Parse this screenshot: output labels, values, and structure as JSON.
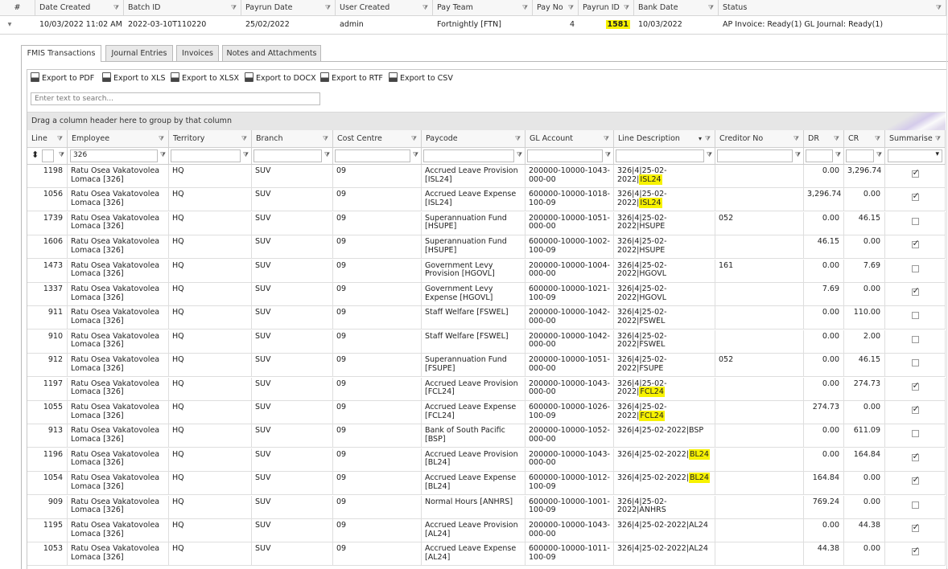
{
  "batch_grid": {
    "headers": [
      "#",
      "Date Created",
      "Batch ID",
      "Payrun Date",
      "User Created",
      "Pay Team",
      "Pay No",
      "Payrun ID",
      "Bank Date",
      "Status"
    ],
    "row": {
      "expand": "▾",
      "date_created": "10/03/2022 11:02 AM",
      "batch_id": "2022-03-10T110220",
      "payrun_date": "25/02/2022",
      "user_created": "admin",
      "pay_team": "Fortnightly [FTN]",
      "pay_no": "4",
      "payrun_id": "1581",
      "bank_date": "10/03/2022",
      "status": "AP Invoice: Ready(1) GL Journal: Ready(1)"
    }
  },
  "tabs": [
    "FMIS Transactions",
    "Journal Entries",
    "Invoices",
    "Notes and Attachments"
  ],
  "toolbar": [
    "Export to PDF",
    "Export to XLS",
    "Export to XLSX",
    "Export to DOCX",
    "Export to RTF",
    "Export to CSV"
  ],
  "search_placeholder": "Enter text to search...",
  "group_hint": "Drag a column header here to group by that column",
  "columns": [
    "Line",
    "Employee",
    "Territory",
    "Branch",
    "Cost Centre",
    "Paycode",
    "GL Account",
    "Line Description",
    "Creditor No",
    "DR",
    "CR",
    "Summarise"
  ],
  "filter_employee": "326",
  "rows": [
    {
      "line": "1198",
      "employee": "Ratu Osea Vakatovolea Lomaca [326]",
      "territory": "HQ",
      "branch": "SUV",
      "cost_centre": "09",
      "paycode": "Accrued Leave Provision [ISL24]",
      "gl": "200000-10000-1043-000-00",
      "desc_pre": "326|4|25-02-2022|",
      "desc_hl": "ISL24",
      "creditor": "",
      "dr": "0.00",
      "cr": "3,296.74",
      "summ": true
    },
    {
      "line": "1056",
      "employee": "Ratu Osea Vakatovolea Lomaca [326]",
      "territory": "HQ",
      "branch": "SUV",
      "cost_centre": "09",
      "paycode": "Accrued Leave Expense [ISL24]",
      "gl": "600000-10000-1018-100-09",
      "desc_pre": "326|4|25-02-2022|",
      "desc_hl": "ISL24",
      "creditor": "",
      "dr": "3,296.74",
      "cr": "0.00",
      "summ": true
    },
    {
      "line": "1739",
      "employee": "Ratu Osea Vakatovolea Lomaca [326]",
      "territory": "HQ",
      "branch": "SUV",
      "cost_centre": "09",
      "paycode": "Superannuation Fund [HSUPE]",
      "gl": "200000-10000-1051-000-00",
      "desc_pre": "326|4|25-02-2022|HSUPE",
      "desc_hl": "",
      "creditor": "052",
      "dr": "0.00",
      "cr": "46.15",
      "summ": false
    },
    {
      "line": "1606",
      "employee": "Ratu Osea Vakatovolea Lomaca [326]",
      "territory": "HQ",
      "branch": "SUV",
      "cost_centre": "09",
      "paycode": "Superannuation Fund [HSUPE]",
      "gl": "600000-10000-1002-100-09",
      "desc_pre": "326|4|25-02-2022|HSUPE",
      "desc_hl": "",
      "creditor": "",
      "dr": "46.15",
      "cr": "0.00",
      "summ": true
    },
    {
      "line": "1473",
      "employee": "Ratu Osea Vakatovolea Lomaca [326]",
      "territory": "HQ",
      "branch": "SUV",
      "cost_centre": "09",
      "paycode": "Government Levy Provision [HGOVL]",
      "gl": "200000-10000-1004-000-00",
      "desc_pre": "326|4|25-02-2022|HGOVL",
      "desc_hl": "",
      "creditor": "161",
      "dr": "0.00",
      "cr": "7.69",
      "summ": false
    },
    {
      "line": "1337",
      "employee": "Ratu Osea Vakatovolea Lomaca [326]",
      "territory": "HQ",
      "branch": "SUV",
      "cost_centre": "09",
      "paycode": "Government Levy Expense [HGOVL]",
      "gl": "600000-10000-1021-100-09",
      "desc_pre": "326|4|25-02-2022|HGOVL",
      "desc_hl": "",
      "creditor": "",
      "dr": "7.69",
      "cr": "0.00",
      "summ": true
    },
    {
      "line": "911",
      "employee": "Ratu Osea Vakatovolea Lomaca [326]",
      "territory": "HQ",
      "branch": "SUV",
      "cost_centre": "09",
      "paycode": "Staff Welfare [FSWEL]",
      "gl": "200000-10000-1042-000-00",
      "desc_pre": "326|4|25-02-2022|FSWEL",
      "desc_hl": "",
      "creditor": "",
      "dr": "0.00",
      "cr": "110.00",
      "summ": false
    },
    {
      "line": "910",
      "employee": "Ratu Osea Vakatovolea Lomaca [326]",
      "territory": "HQ",
      "branch": "SUV",
      "cost_centre": "09",
      "paycode": "Staff Welfare [FSWEL]",
      "gl": "200000-10000-1042-000-00",
      "desc_pre": "326|4|25-02-2022|FSWEL",
      "desc_hl": "",
      "creditor": "",
      "dr": "0.00",
      "cr": "2.00",
      "summ": false
    },
    {
      "line": "912",
      "employee": "Ratu Osea Vakatovolea Lomaca [326]",
      "territory": "HQ",
      "branch": "SUV",
      "cost_centre": "09",
      "paycode": "Superannuation Fund [FSUPE]",
      "gl": "200000-10000-1051-000-00",
      "desc_pre": "326|4|25-02-2022|FSUPE",
      "desc_hl": "",
      "creditor": "052",
      "dr": "0.00",
      "cr": "46.15",
      "summ": false
    },
    {
      "line": "1197",
      "employee": "Ratu Osea Vakatovolea Lomaca [326]",
      "territory": "HQ",
      "branch": "SUV",
      "cost_centre": "09",
      "paycode": "Accrued Leave Provision [FCL24]",
      "gl": "200000-10000-1043-000-00",
      "desc_pre": "326|4|25-02-2022|",
      "desc_hl": "FCL24",
      "creditor": "",
      "dr": "0.00",
      "cr": "274.73",
      "summ": true
    },
    {
      "line": "1055",
      "employee": "Ratu Osea Vakatovolea Lomaca [326]",
      "territory": "HQ",
      "branch": "SUV",
      "cost_centre": "09",
      "paycode": "Accrued Leave Expense [FCL24]",
      "gl": "600000-10000-1026-100-09",
      "desc_pre": "326|4|25-02-2022|",
      "desc_hl": "FCL24",
      "creditor": "",
      "dr": "274.73",
      "cr": "0.00",
      "summ": true
    },
    {
      "line": "913",
      "employee": "Ratu Osea Vakatovolea Lomaca [326]",
      "territory": "HQ",
      "branch": "SUV",
      "cost_centre": "09",
      "paycode": "Bank of South Pacific [BSP]",
      "gl": "200000-10000-1052-000-00",
      "desc_pre": "326|4|25-02-2022|BSP",
      "desc_hl": "",
      "creditor": "",
      "dr": "0.00",
      "cr": "611.09",
      "summ": false
    },
    {
      "line": "1196",
      "employee": "Ratu Osea Vakatovolea Lomaca [326]",
      "territory": "HQ",
      "branch": "SUV",
      "cost_centre": "09",
      "paycode": "Accrued Leave Provision [BL24]",
      "gl": "200000-10000-1043-000-00",
      "desc_pre": "326|4|25-02-2022|",
      "desc_hl": "BL24",
      "creditor": "",
      "dr": "0.00",
      "cr": "164.84",
      "summ": true
    },
    {
      "line": "1054",
      "employee": "Ratu Osea Vakatovolea Lomaca [326]",
      "territory": "HQ",
      "branch": "SUV",
      "cost_centre": "09",
      "paycode": "Accrued Leave Expense [BL24]",
      "gl": "600000-10000-1012-100-09",
      "desc_pre": "326|4|25-02-2022|",
      "desc_hl": "BL24",
      "creditor": "",
      "dr": "164.84",
      "cr": "0.00",
      "summ": true
    },
    {
      "line": "909",
      "employee": "Ratu Osea Vakatovolea Lomaca [326]",
      "territory": "HQ",
      "branch": "SUV",
      "cost_centre": "09",
      "paycode": "Normal Hours [ANHRS]",
      "gl": "600000-10000-1001-100-09",
      "desc_pre": "326|4|25-02-2022|ANHRS",
      "desc_hl": "",
      "creditor": "",
      "dr": "769.24",
      "cr": "0.00",
      "summ": false
    },
    {
      "line": "1195",
      "employee": "Ratu Osea Vakatovolea Lomaca [326]",
      "territory": "HQ",
      "branch": "SUV",
      "cost_centre": "09",
      "paycode": "Accrued Leave Provision [AL24]",
      "gl": "200000-10000-1043-000-00",
      "desc_pre": "326|4|25-02-2022|AL24",
      "desc_hl": "",
      "creditor": "",
      "dr": "0.00",
      "cr": "44.38",
      "summ": true
    },
    {
      "line": "1053",
      "employee": "Ratu Osea Vakatovolea Lomaca [326]",
      "territory": "HQ",
      "branch": "SUV",
      "cost_centre": "09",
      "paycode": "Accrued Leave Expense [AL24]",
      "gl": "600000-10000-1011-100-09",
      "desc_pre": "326|4|25-02-2022|AL24",
      "desc_hl": "",
      "creditor": "",
      "dr": "44.38",
      "cr": "0.00",
      "summ": true
    }
  ],
  "colors": {
    "highlight": "#f7f200",
    "header_bg": "#f7f7f7",
    "group_bar": "#e6e6e6"
  }
}
